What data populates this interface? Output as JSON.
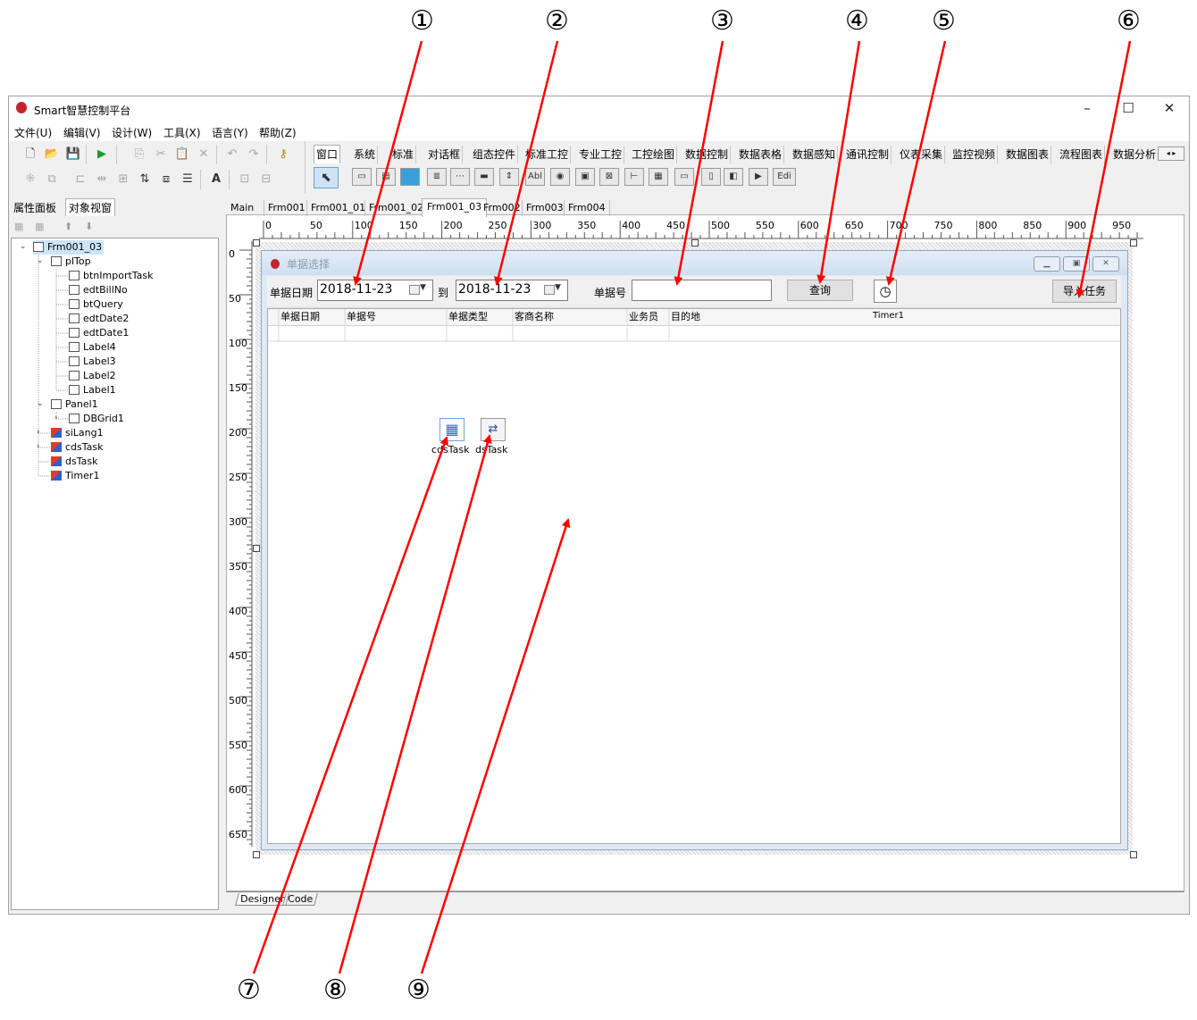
{
  "window": {
    "title": "Smart智慧控制平台",
    "controls": [
      "–",
      "☐",
      "✕"
    ]
  },
  "menu": [
    "文件(U)",
    "编辑(V)",
    "设计(W)",
    "工具(X)",
    "语言(Y)",
    "帮助(Z)"
  ],
  "palette_tabs": [
    "窗口",
    "系统",
    "标准",
    "对话框",
    "组态控件",
    "标准工控",
    "专业工控",
    "工控绘图",
    "数据控制",
    "数据表格",
    "数据感知",
    "通讯控制",
    "仪表采集",
    "监控视频",
    "数据图表",
    "流程图表",
    "数据分析"
  ],
  "palette_extra": "Edi",
  "left_tabs": [
    "属性面板",
    "对象视窗"
  ],
  "tree": [
    {
      "label": "Frm001_03",
      "level": 0
    },
    {
      "label": "plTop",
      "level": 1
    },
    {
      "label": "btnImportTask",
      "level": 2
    },
    {
      "label": "edtBillNo",
      "level": 2
    },
    {
      "label": "btQuery",
      "level": 2
    },
    {
      "label": "edtDate2",
      "level": 2
    },
    {
      "label": "edtDate1",
      "level": 2
    },
    {
      "label": "Label4",
      "level": 2
    },
    {
      "label": "Label3",
      "level": 2
    },
    {
      "label": "Label2",
      "level": 2
    },
    {
      "label": "Label1",
      "level": 2
    },
    {
      "label": "Panel1",
      "level": 1
    },
    {
      "label": "DBGrid1",
      "level": 2
    },
    {
      "label": "siLang1",
      "level": 1
    },
    {
      "label": "cdsTask",
      "level": 1
    },
    {
      "label": "dsTask",
      "level": 1
    },
    {
      "label": "Timer1",
      "level": 1
    }
  ],
  "doc_tabs": [
    "Main",
    "Frm001",
    "Frm001_01",
    "Frm001_02",
    "Frm001_03",
    "Frm002",
    "Frm003",
    "Frm004"
  ],
  "active_doc_tab": "Frm001_03",
  "ruler": {
    "h": [
      "0",
      "50",
      "100",
      "150",
      "200",
      "250",
      "300",
      "350",
      "400",
      "450",
      "500",
      "550",
      "600",
      "650",
      "700",
      "750",
      "800",
      "850",
      "900",
      "950"
    ],
    "v": [
      "0",
      "50",
      "100",
      "150",
      "200",
      "250",
      "300",
      "350",
      "400",
      "450",
      "500",
      "550",
      "600",
      "650"
    ]
  },
  "form": {
    "title": "单据选择",
    "label_date": "单据日期",
    "date1": "2018-11-23",
    "label_to": "到",
    "date2": "2018-11-23",
    "label_billno": "单据号",
    "billno_value": "",
    "query_button": "查询",
    "import_button": "导入任务",
    "timer_label": "Timer1",
    "grid_columns": [
      "单据日期",
      "单据号",
      "单据类型",
      "客商名称",
      "业务员",
      "目的地"
    ],
    "components": [
      "cdsTask",
      "dsTask"
    ]
  },
  "bottom_tabs": [
    "Designer",
    "Code"
  ],
  "annotations": [
    "①",
    "②",
    "③",
    "④",
    "⑤",
    "⑥",
    "⑦",
    "⑧",
    "⑨"
  ],
  "colors": {
    "annotation_arrow": "#ff0000",
    "form_title_gradient": "#cfdff1"
  }
}
